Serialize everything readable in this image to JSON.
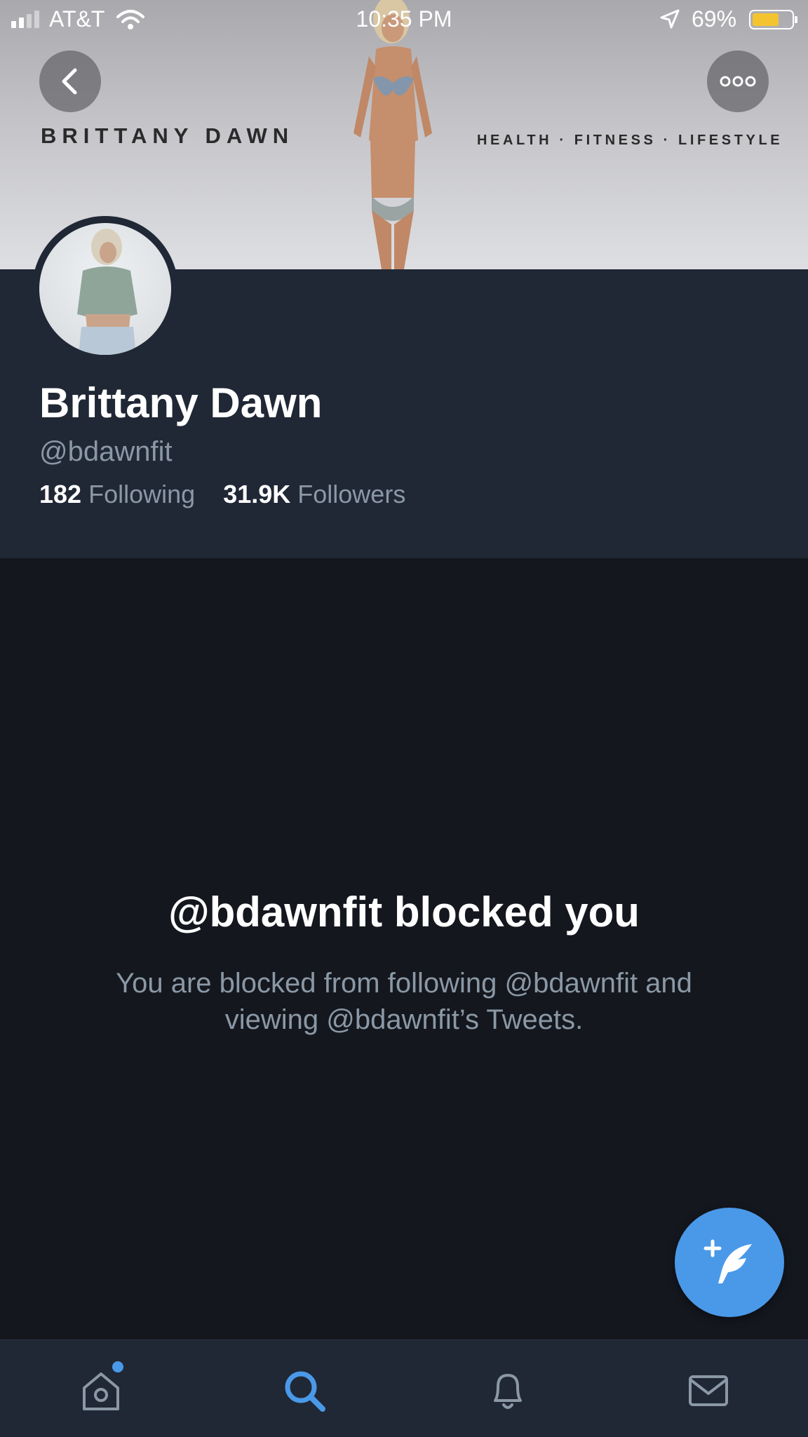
{
  "status_bar": {
    "carrier": "AT&T",
    "time": "10:35 PM",
    "battery_percent": "69%",
    "battery_level": 0.69,
    "battery_color": "#f4c430"
  },
  "banner": {
    "brand_name": "BRITTANY DAWN",
    "tagline": "HEALTH · FITNESS · LIFESTYLE",
    "back_icon": "chevron-left-icon",
    "more_icon": "more-horizontal-icon"
  },
  "profile": {
    "display_name": "Brittany Dawn",
    "handle": "@bdawnfit",
    "following_count": "182",
    "following_label": "Following",
    "followers_count": "31.9K",
    "followers_label": "Followers"
  },
  "blocked": {
    "title": "@bdawnfit blocked you",
    "description": "You are blocked from following @bdawnfit and viewing @bdawnfit’s Tweets."
  },
  "fab": {
    "icon": "compose-tweet-icon",
    "color": "#4a99e9"
  },
  "tab_bar": {
    "tabs": [
      {
        "name": "home",
        "icon": "home-icon",
        "has_notification_dot": true
      },
      {
        "name": "search",
        "icon": "search-icon",
        "active": true
      },
      {
        "name": "notifications",
        "icon": "bell-icon"
      },
      {
        "name": "messages",
        "icon": "mail-icon"
      }
    ],
    "active_color": "#4a99e9"
  }
}
